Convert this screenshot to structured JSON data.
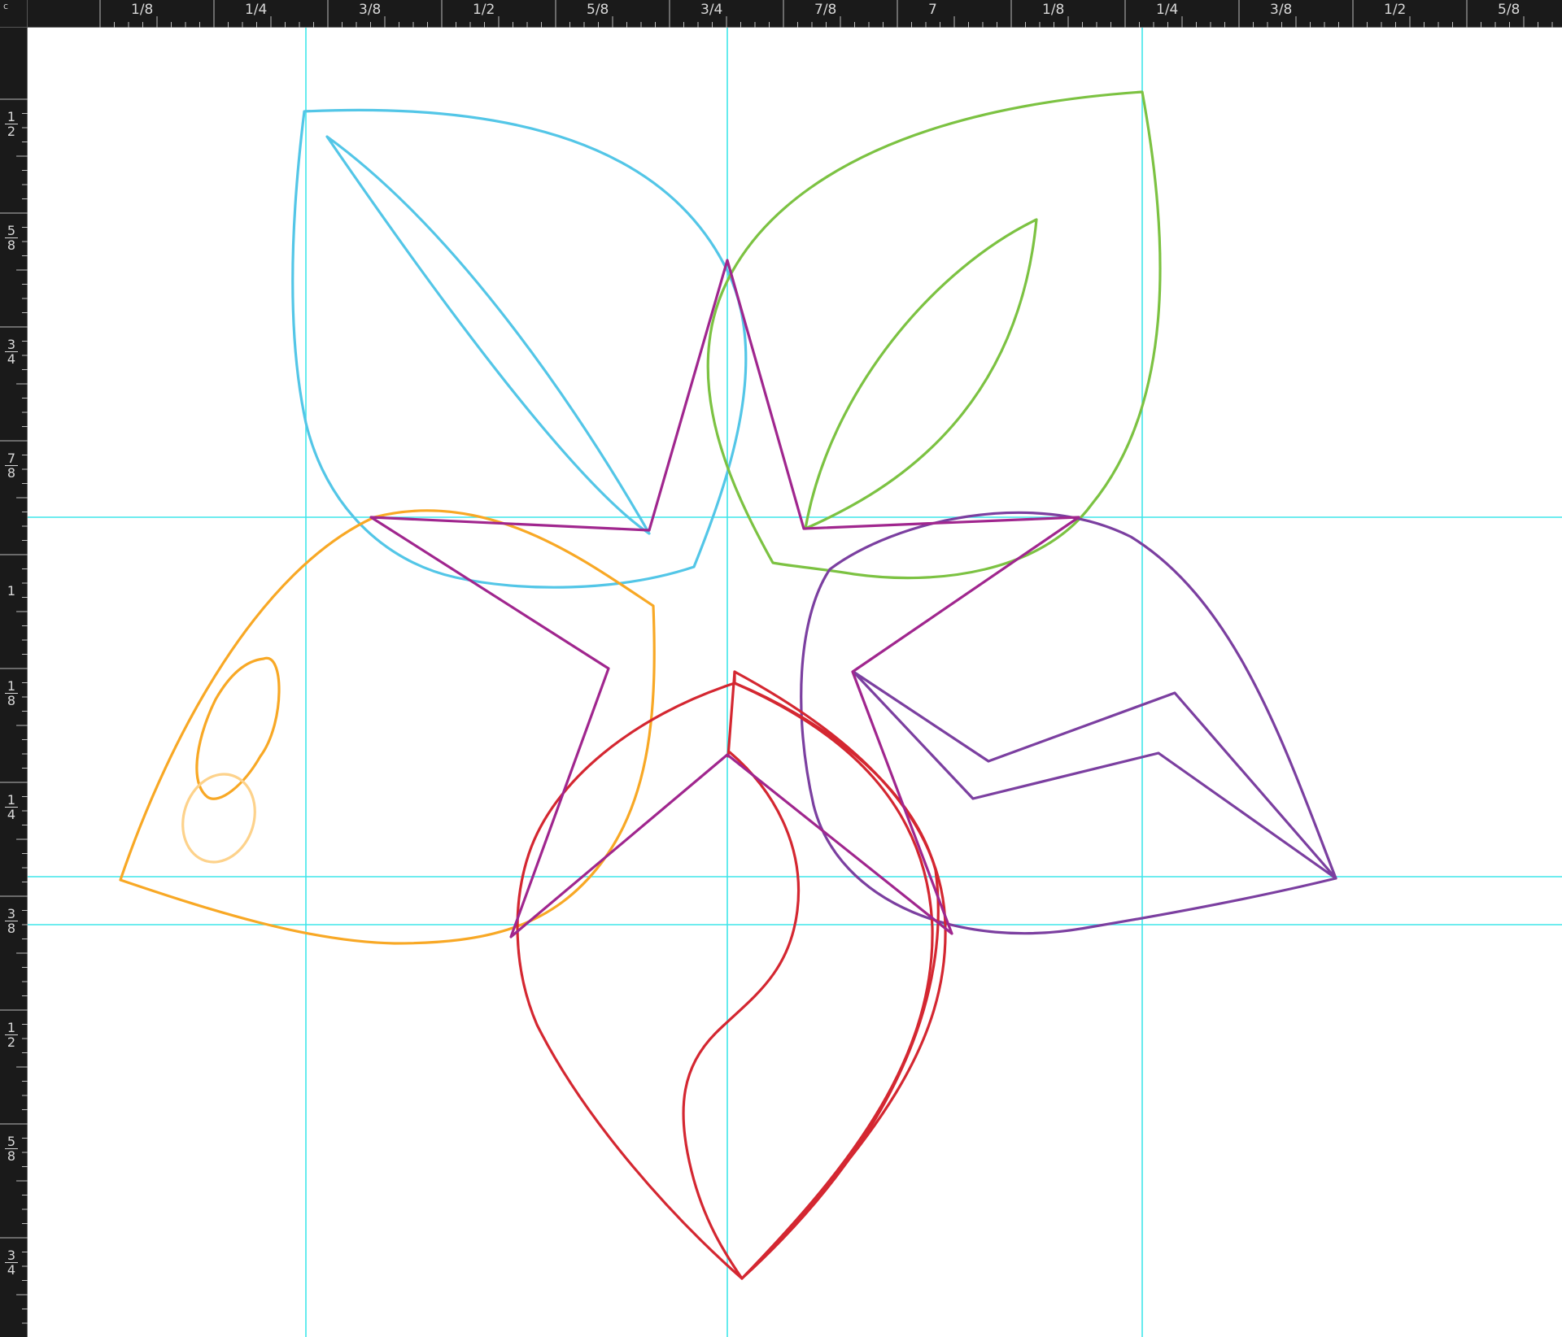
{
  "corner": {
    "icon": "ruler-origin-icon",
    "glyph": "c"
  },
  "ruler": {
    "top_labels": [
      "1/8",
      "1/4",
      "3/8",
      "1/2",
      "5/8",
      "3/4",
      "7/8",
      "7",
      "1/8",
      "1/4",
      "3/8",
      "1/2",
      "5/8"
    ],
    "left_labels": [
      {
        "num": "1",
        "den": "2"
      },
      {
        "num": "5",
        "den": "8"
      },
      {
        "num": "3",
        "den": "4"
      },
      {
        "num": "7",
        "den": "8"
      },
      {
        "num": "1",
        "den": ""
      },
      {
        "num": "1",
        "den": "8"
      },
      {
        "num": "1",
        "den": "4"
      },
      {
        "num": "3",
        "den": "8"
      },
      {
        "num": "1",
        "den": "2"
      },
      {
        "num": "5",
        "den": "8"
      },
      {
        "num": "3",
        "den": "4"
      }
    ]
  },
  "colors": {
    "guide": "#3fe6ea",
    "blue_petal": "#53c6e7",
    "green_petal": "#7cc242",
    "orange_petal": "#f8a825",
    "orange_light": "#fdd28b",
    "purple_petal": "#7b3fa0",
    "red_petal": "#d42731",
    "star": "#a0268e"
  }
}
